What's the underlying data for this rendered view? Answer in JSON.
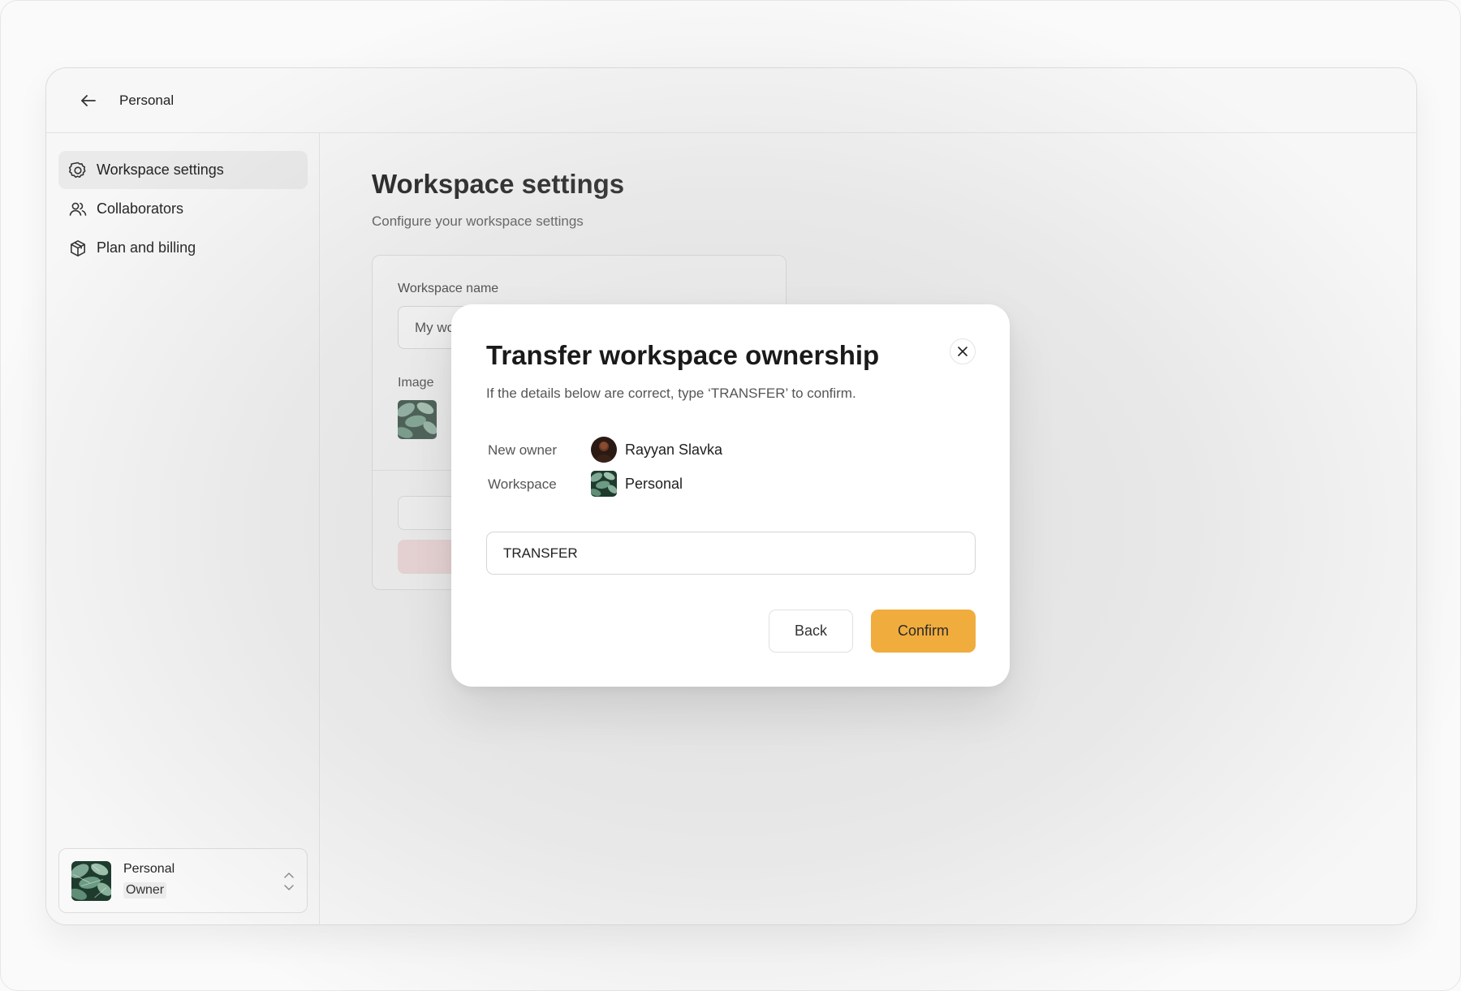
{
  "topbar": {
    "back_icon": "arrow-left-icon",
    "title": "Personal"
  },
  "sidebar": {
    "items": [
      {
        "label": "Workspace settings",
        "icon": "gear-icon",
        "active": true
      },
      {
        "label": "Collaborators",
        "icon": "users-icon",
        "active": false
      },
      {
        "label": "Plan and billing",
        "icon": "package-icon",
        "active": false
      }
    ],
    "workspace_switcher": {
      "name": "Personal",
      "role": "Owner",
      "icon": "chevron-up-down-icon"
    }
  },
  "main": {
    "title": "Workspace settings",
    "subtitle": "Configure your workspace settings",
    "card": {
      "name_label": "Workspace name",
      "name_value": "My wo",
      "image_label": "Image"
    }
  },
  "modal": {
    "title": "Transfer workspace ownership",
    "description": "If the details below are correct, type ‘TRANSFER’ to confirm.",
    "details": {
      "new_owner_label": "New owner",
      "new_owner_value": "Rayyan Slavka",
      "workspace_label": "Workspace",
      "workspace_value": "Personal"
    },
    "confirm_input_value": "TRANSFER",
    "back_label": "Back",
    "confirm_label": "Confirm",
    "close_icon": "close-icon"
  },
  "colors": {
    "accent": "#f0ad3e",
    "danger_soft": "#f6d9d9",
    "active_nav": "#eaeaea"
  }
}
